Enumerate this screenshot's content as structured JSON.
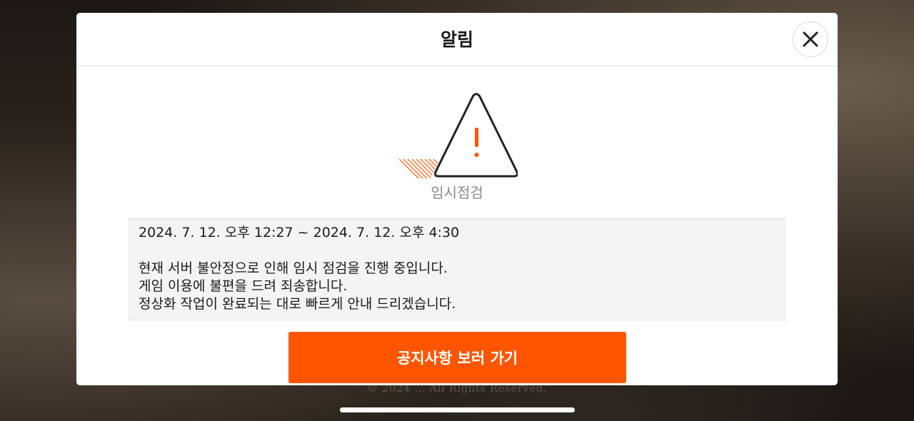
{
  "background": {
    "footer_text": "© 2024 ... All Rights Reserved."
  },
  "modal": {
    "title": "알림",
    "close_icon": "close-icon",
    "status_icon": "warning-triangle-icon",
    "status_label": "임시점검",
    "notice": {
      "period": "2024. 7. 12. 오후 12:27 ~ 2024. 7. 12. 오후 4:30",
      "lines": [
        "현재 서버 불안정으로 인해 임시 점검을 진행 중입니다.",
        "게임 이용에 불편을 드려 죄송합니다.",
        "정상화 작업이 완료되는 대로 빠르게 안내 드리겠습니다."
      ]
    },
    "primary_button_label": "공지사항 보러 가기"
  },
  "colors": {
    "accent": "#ff5500",
    "title_text": "#1a1a1a",
    "status_label": "#8a8a8a",
    "notice_background": "#f4f4f4"
  }
}
